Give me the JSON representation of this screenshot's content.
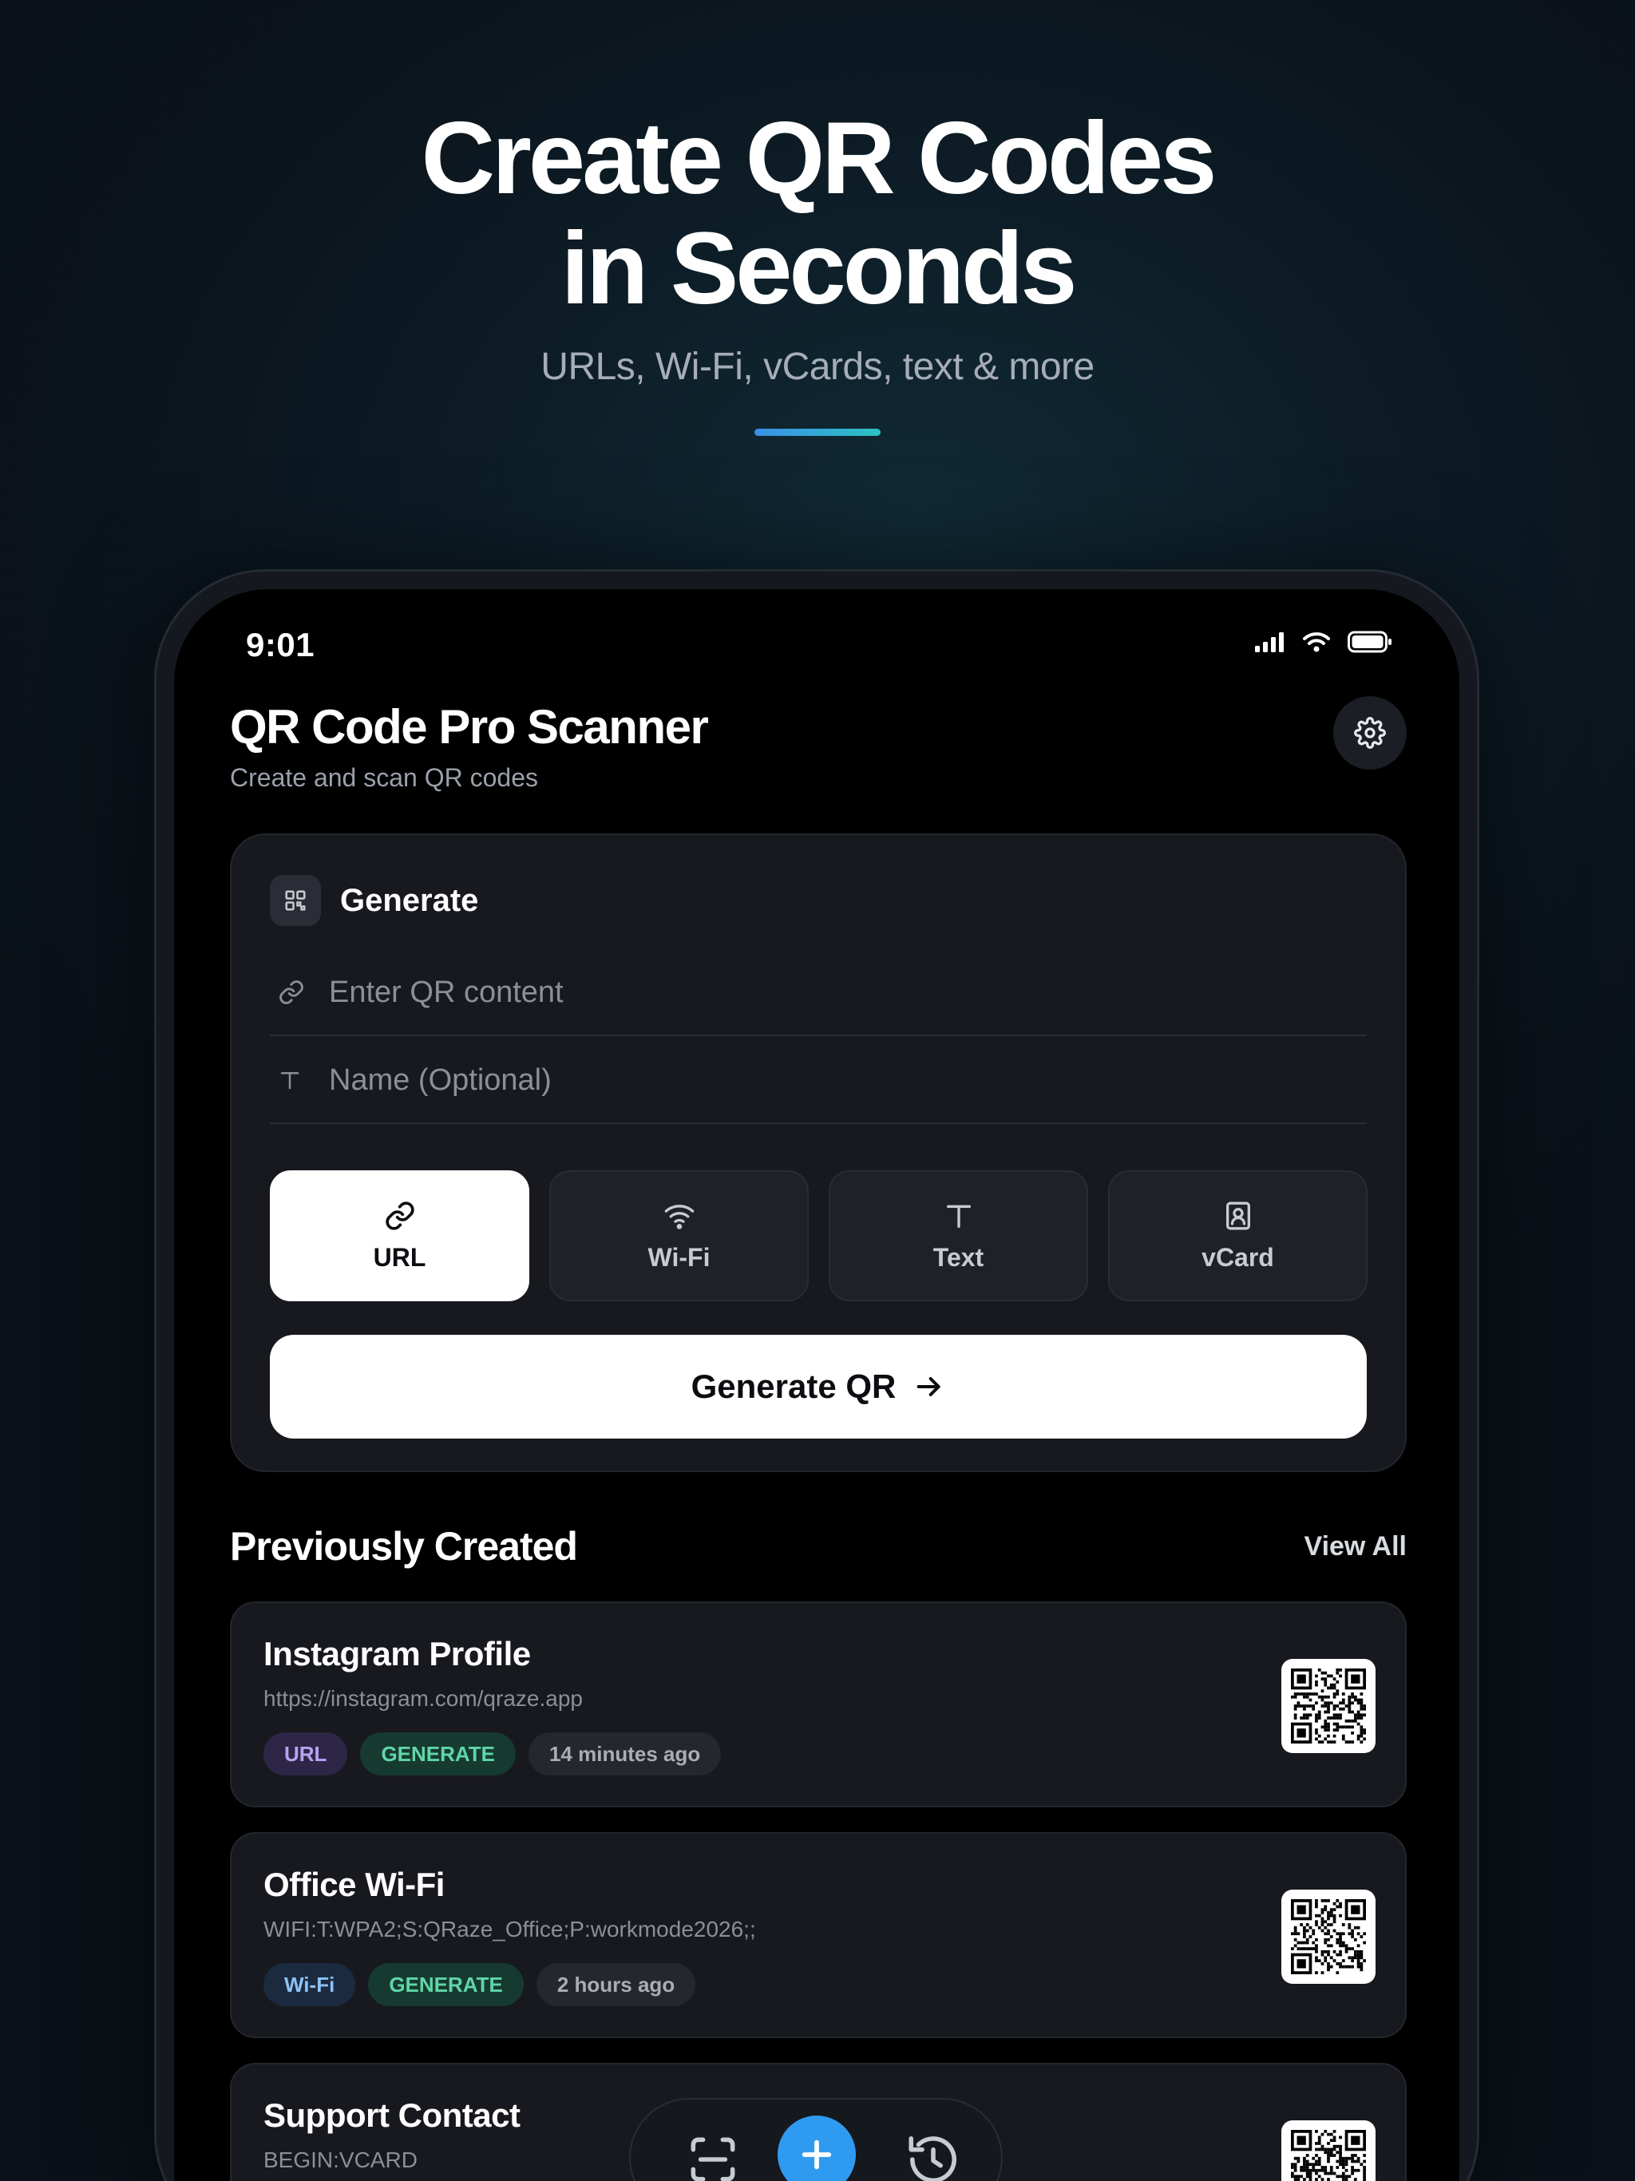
{
  "hero": {
    "title_line1": "Create QR Codes",
    "title_line2": "in Seconds",
    "subtitle": "URLs, Wi-Fi, vCards, text & more"
  },
  "status_bar": {
    "time": "9:01"
  },
  "app": {
    "title": "QR Code Pro Scanner",
    "subtitle": "Create and scan QR codes"
  },
  "generate": {
    "heading": "Generate",
    "content_placeholder": "Enter QR content",
    "name_placeholder": "Name (Optional)",
    "types": [
      {
        "label": "URL",
        "icon": "link-icon",
        "active": true
      },
      {
        "label": "Wi-Fi",
        "icon": "wifi-icon",
        "active": false
      },
      {
        "label": "Text",
        "icon": "text-icon",
        "active": false
      },
      {
        "label": "vCard",
        "icon": "contact-card-icon",
        "active": false
      }
    ],
    "button_label": "Generate QR"
  },
  "history": {
    "heading": "Previously Created",
    "view_all": "View All",
    "items": [
      {
        "name": "Instagram Profile",
        "content": "https://instagram.com/qraze.app",
        "type_badge": "URL",
        "source_badge": "GENERATE",
        "time": "14 minutes ago"
      },
      {
        "name": "Office Wi-Fi",
        "content": "WIFI:T:WPA2;S:QRaze_Office;P:workmode2026;;",
        "type_badge": "Wi-Fi",
        "source_badge": "GENERATE",
        "time": "2 hours ago"
      },
      {
        "name": "Support Contact",
        "content": "BEGIN:VCARD"
      }
    ]
  },
  "tab_bar": {
    "items": [
      "scan-icon",
      "plus-icon",
      "history-icon"
    ]
  },
  "colors": {
    "accent": "#2f9bf0",
    "url_badge_bg": "#2e2646",
    "url_badge_fg": "#b6a4f0",
    "wifi_badge_bg": "#1c2a40",
    "wifi_badge_fg": "#8cc2f5",
    "generate_badge_bg": "#163a30",
    "generate_badge_fg": "#5fd6a8",
    "time_badge_bg": "#25272c",
    "time_badge_fg": "#a9adb5"
  }
}
